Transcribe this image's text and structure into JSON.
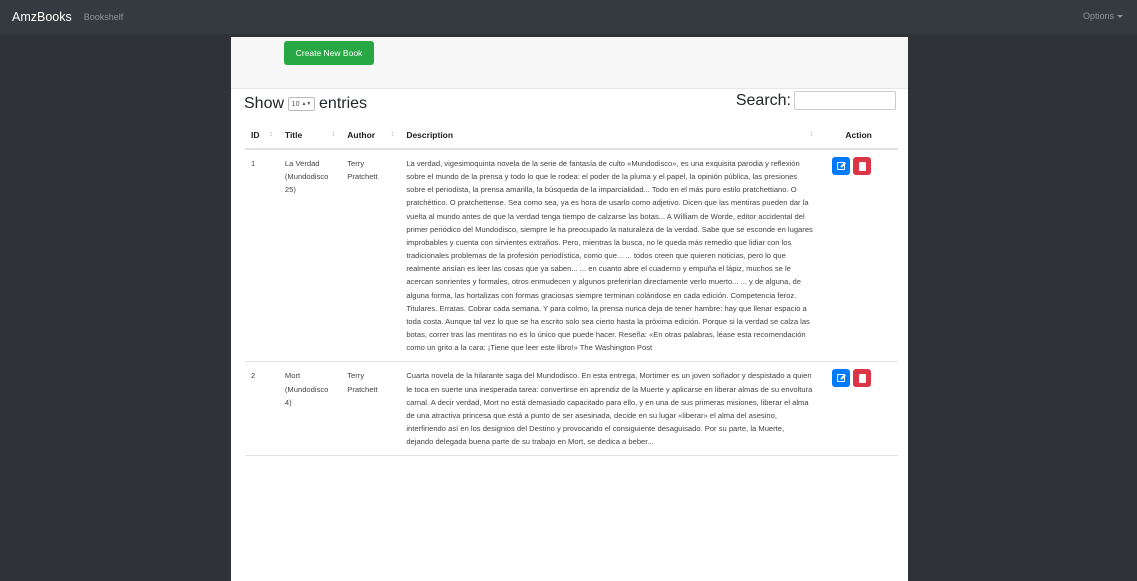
{
  "navbar": {
    "brand": "AmzBooks",
    "link": "Bookshelf",
    "options": "Options"
  },
  "toolbar": {
    "create_label": "Create New Book"
  },
  "table_controls": {
    "show_label": "Show",
    "length_value": "10",
    "entries_label": "entries",
    "search_label": "Search:"
  },
  "table": {
    "headers": {
      "id": "ID",
      "title": "Title",
      "author": "Author",
      "description": "Description",
      "action": "Action"
    },
    "rows": [
      {
        "id": "1",
        "title": "La Verdad (Mundodisco 25)",
        "author": "Terry Pratchett",
        "description": "La verdad, vigesimoquinta novela de la serie de fantasía de culto «Mundodisco», es una exquisita parodia y reflexión sobre el mundo de la prensa y todo lo que le rodea: el poder de la pluma y el papel, la opinión pública, las presiones sobre el periodista, la prensa amarilla, la búsqueda de la imparcialidad... Todo en el más puro estilo pratchettiano. O pratchéttico. O pratchettense. Sea como sea, ya es hora de usarlo como adjetivo. Dicen que las mentiras pueden dar la vuelta al mundo antes de que la verdad tenga tiempo de calzarse las botas... A William de Worde, editor accidental del primer periódico del Mundodisco, siempre le ha preocupado la naturaleza de la verdad. Sabe que se esconde en lugares improbables y cuenta con sirvientes extraños. Pero, mientras la busca, no le queda más remedio que lidiar con los tradicionales problemas de la profesión periodística, como que... ... todos creen que quieren noticias, pero lo que realmente ansían es leer las cosas que ya saben... ... en cuanto abre el cuaderno y empuña el lápiz, muchos se le acercan sonrientes y formales, otros enmudecen y algunos preferirían directamente verlo muerto... ... y de alguna, de alguna forma, las hortalizas con formas graciosas siempre terminan colándose en cada edición. Competencia feroz. Titulares. Erratas. Cobrar cada semana. Y para colmo, la prensa nunca deja de tener hambre: hay que llenar espacio a toda costa. Aunque tal vez lo que se ha escrito solo sea cierto hasta la próxima edición. Porque si la verdad se calza las botas, correr tras las mentiras no es lo único que puede hacer. Reseña: «En otras palabras, léase esta recomendación como un grito a la cara: ¡Tiene que leer este libro!» The Washington Post"
      },
      {
        "id": "2",
        "title": "Mort (Mundodisco 4)",
        "author": "Terry Pratchett",
        "description": "Cuarta novela de la hilarante saga del Mundodisco. En esta entrega, Mortimer es un joven soñador y despistado a quien le toca en suerte una inesperada tarea: convertirse en aprendiz de la Muerte y aplicarse en liberar almas de su envoltura carnal. A decir verdad, Mort no está demasiado capacitado para ello, y en una de sus primeras misiones, liberar el alma de una atractiva princesa que está a punto de ser asesinada, decide en su lugar «liberar» el alma del asesino, interfiriendo así en los designios del Destino y provocando el consiguiente desaguisado. Por su parte, la Muerte, dejando delegada buena parte de su trabajo en Mort, se dedica a beber..."
      }
    ]
  },
  "colors": {
    "navbar": "#343a40",
    "create_button": "#28a745",
    "edit_button": "#007bff",
    "delete_button": "#dc3545"
  },
  "icons": [
    "edit-icon",
    "trash-icon",
    "sort-icon",
    "caret-down-icon"
  ]
}
